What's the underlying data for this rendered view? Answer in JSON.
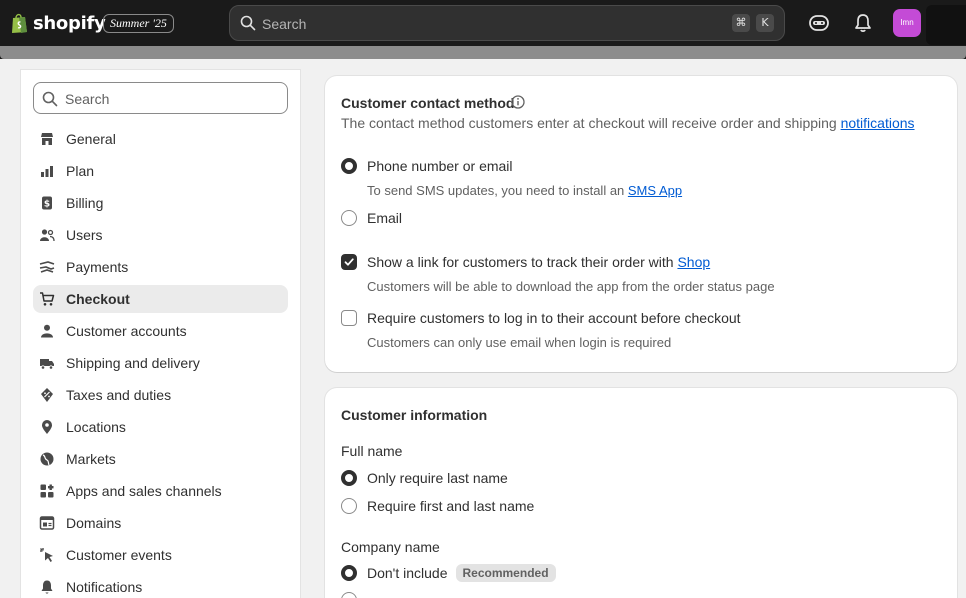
{
  "topbar": {
    "brand": "shopify",
    "edition": "Summer '25",
    "search_placeholder": "Search",
    "kbd_cmd": "⌘",
    "kbd_k": "K",
    "avatar_initials": "Imn"
  },
  "sidebar": {
    "search_placeholder": "Search",
    "items": [
      {
        "label": "General",
        "icon": "store-icon"
      },
      {
        "label": "Plan",
        "icon": "plan-icon"
      },
      {
        "label": "Billing",
        "icon": "billing-icon"
      },
      {
        "label": "Users",
        "icon": "users-icon"
      },
      {
        "label": "Payments",
        "icon": "payments-icon"
      },
      {
        "label": "Checkout",
        "icon": "cart-icon",
        "active": true
      },
      {
        "label": "Customer accounts",
        "icon": "person-icon"
      },
      {
        "label": "Shipping and delivery",
        "icon": "truck-icon"
      },
      {
        "label": "Taxes and duties",
        "icon": "tax-icon"
      },
      {
        "label": "Locations",
        "icon": "location-icon"
      },
      {
        "label": "Markets",
        "icon": "globe-icon"
      },
      {
        "label": "Apps and sales channels",
        "icon": "apps-icon"
      },
      {
        "label": "Domains",
        "icon": "domain-icon"
      },
      {
        "label": "Customer events",
        "icon": "events-icon"
      },
      {
        "label": "Notifications",
        "icon": "bell-icon"
      }
    ]
  },
  "contact": {
    "title": "Customer contact method",
    "subtitle": "The contact method customers enter at checkout will receive order and shipping ",
    "subtitle_link": "notifications",
    "opt_phone": "Phone number or email",
    "opt_phone_help": "To send SMS updates, you need to install an ",
    "opt_phone_help_link": "SMS App",
    "opt_email": "Email",
    "track_label": "Show a link for customers to track their order with ",
    "track_link": "Shop",
    "track_help": "Customers will be able to download the app from the order status page",
    "login_label": "Require customers to log in to their account before checkout",
    "login_help": "Customers can only use email when login is required"
  },
  "info": {
    "title": "Customer information",
    "fullname_label": "Full name",
    "fullname_opt1": "Only require last name",
    "fullname_opt2": "Require first and last name",
    "company_label": "Company name",
    "company_opt1": "Don't include",
    "company_badge": "Recommended"
  },
  "colors": {
    "topbar": "#1a1a1a",
    "avatar": "#c44bd6",
    "link": "#005bd3",
    "brand_green": "#95bf47"
  }
}
